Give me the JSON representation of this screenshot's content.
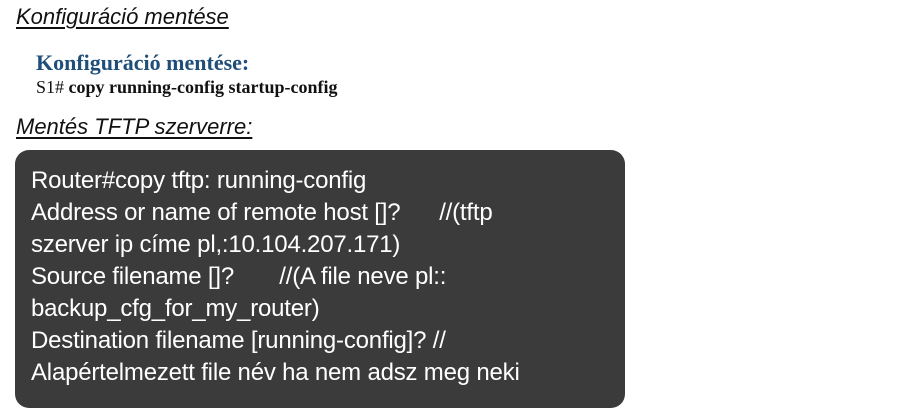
{
  "headings": {
    "save_config": "Konfiguráció mentése",
    "tftp_save": "Mentés TFTP szerverre:"
  },
  "save_block": {
    "title": "Konfiguráció mentése:",
    "prompt": "S1#",
    "command": "copy running-config startup-config"
  },
  "console": {
    "lines": [
      "Router#copy tftp: running-config",
      "Address or name of remote host []?      //(tftp",
      "szerver ip címe pl,:10.104.207.171)",
      "Source filename []?       //(A file neve pl::",
      "backup_cfg_for_my_router)",
      "Destination filename [running-config]? //",
      "Alapértelmezett file név ha nem adsz meg neki"
    ]
  }
}
